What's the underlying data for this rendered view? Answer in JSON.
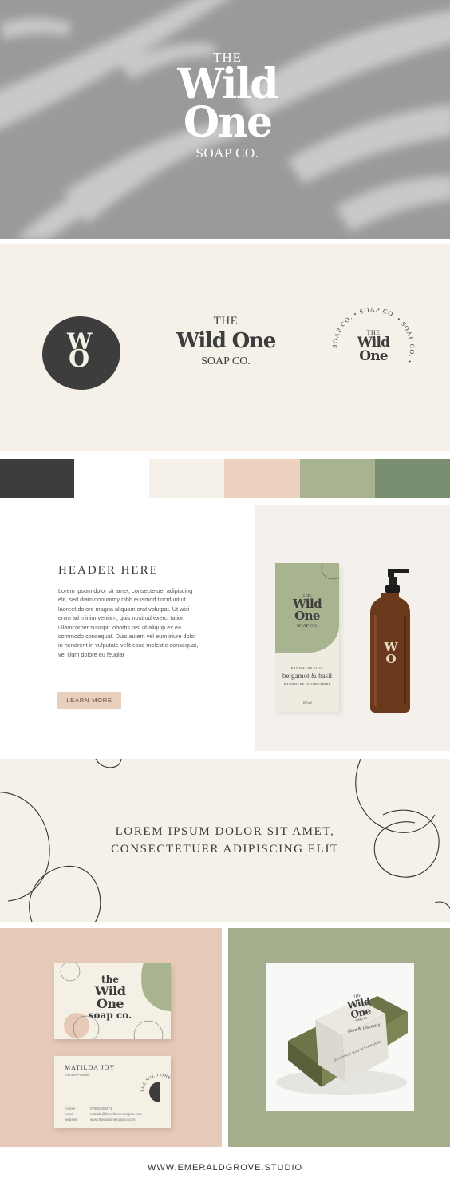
{
  "hero": {
    "the": "THE",
    "wild": "Wild",
    "one": "One",
    "soap": "SOAP CO."
  },
  "logos": {
    "monogram_w": "W",
    "monogram_o": "O",
    "wordmark_the": "THE",
    "wordmark_name": "Wild One",
    "wordmark_soap": "SOAP CO.",
    "badge_the": "THE",
    "badge_wild": "Wild",
    "badge_one": "One",
    "badge_ring": "SOAP CO. • SOAP CO. • SOAP CO. •"
  },
  "palette": [
    "#3d3d3d",
    "#ffffff",
    "#f5f1e8",
    "#ecd2bf",
    "#a8b38f",
    "#7a8f70"
  ],
  "content": {
    "header": "HEADER HERE",
    "body": "Lorem ipsum dolor sit amet, consectetuer adipiscing elit, sed diam nonummy nibh euismod tincidunt ut laoreet dolore magna aliquam erat volutpat. Ut wisi enim ad minim veniam, quis nostrud exerci tation ullamcorper suscipit lobortis nisl ut aliquip ex ea commodo consequat. Duis autem vel eum iriure dolor in hendrerit in vulputate velit esse molestie consequat, vel illum dolore eu feugiat",
    "button": "LEARN MORE"
  },
  "box": {
    "the": "THE",
    "wild": "Wild",
    "one": "One",
    "soap": "SOAP CO.",
    "small_top": "HANDMADE SOAP",
    "scent": "bergamot & basil",
    "small_bottom": "HANDMADE IN YORKSHIRE",
    "volume": "100 ml"
  },
  "bottle": {
    "mono_w": "W",
    "mono_o": "O"
  },
  "quote": {
    "line1": "LOREM IPSUM DOLOR SIT AMET,",
    "line2": "CONSECTETUER ADIPISCING ELIT"
  },
  "card_front": {
    "the": "the",
    "wild": "Wild",
    "one": "One",
    "soap": "soap co."
  },
  "card_back": {
    "name": "MATILDA JOY",
    "role": "founder • maker",
    "labels": [
      "mobile",
      "email",
      "website"
    ],
    "values": [
      "07900208271",
      "matilda@thewildonesoapco.com",
      "www.thewildonesoapco.com"
    ],
    "ring": "THE WILD ONE SOAP CO"
  },
  "soap_bar": {
    "the": "THE",
    "wild": "Wild",
    "one": "One",
    "soap": "soap co.",
    "scent": "olive & rosemary",
    "sub": "HANDMADE SOAP IN YORKSHIRE"
  },
  "footer": "WWW.EMERALDGROVE.STUDIO"
}
